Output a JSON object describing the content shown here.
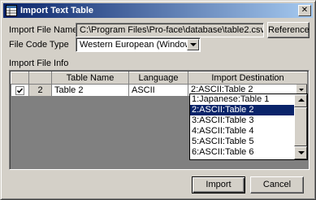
{
  "window": {
    "title": "Import Text Table",
    "close_label": "✕"
  },
  "form": {
    "file_name_label": "Import File Name",
    "file_name_value": "C:\\Program Files\\Pro-face\\database\\table2.csv",
    "reference_label": "Reference",
    "file_code_label": "File Code Type",
    "file_code_value": "Western European (Windows)",
    "import_info_label": "Import File Info"
  },
  "grid": {
    "columns": [
      "",
      "",
      "Table Name",
      "Language",
      "Import Destination"
    ],
    "rows": [
      {
        "checked": true,
        "num": "2",
        "table_name": "Table 2",
        "language": "ASCII",
        "destination": "2:ASCII:Table 2"
      }
    ]
  },
  "dropdown": {
    "options": [
      "1:Japanese:Table 1",
      "2:ASCII:Table 2",
      "3:ASCII:Table 3",
      "4:ASCII:Table 4",
      "5:ASCII:Table 5",
      "6:ASCII:Table 6"
    ],
    "selected_index": 1
  },
  "buttons": {
    "import_label": "Import",
    "cancel_label": "Cancel"
  },
  "colors": {
    "selection": "#0a246a",
    "face": "#d4d0c8"
  }
}
